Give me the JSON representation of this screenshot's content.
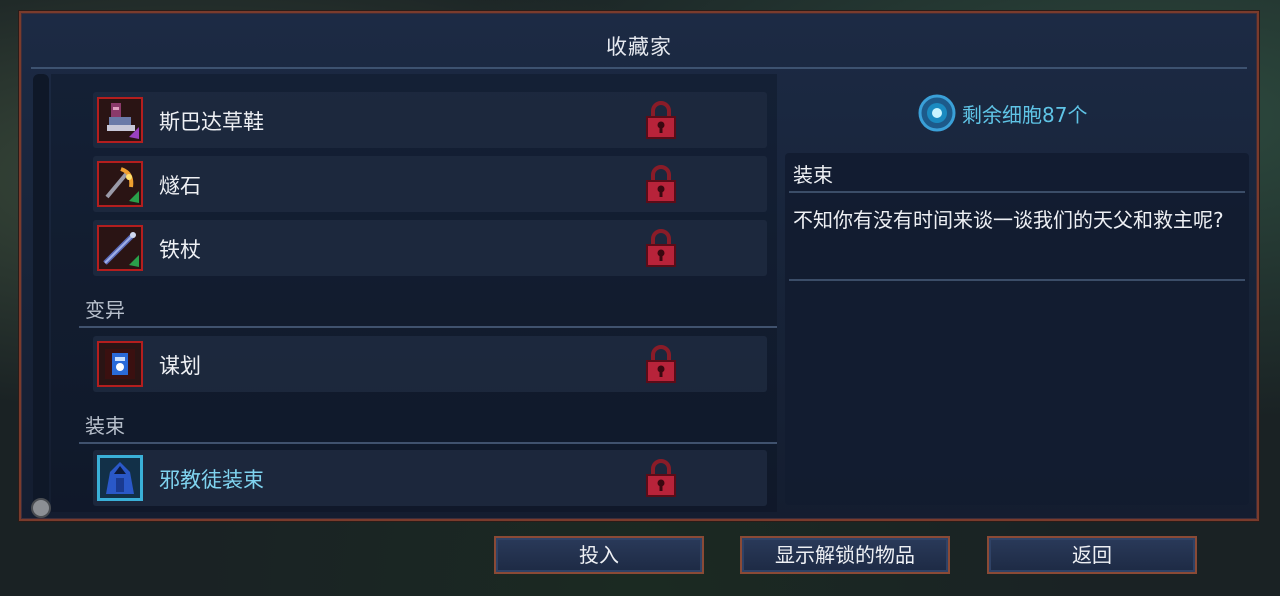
{
  "window": {
    "title": "收藏家"
  },
  "colors": {
    "accent": "#5fc4e6",
    "lock": "#c0283a",
    "frame": "#7a3b2c"
  },
  "list": {
    "group1_items": [
      {
        "label": "斯巴达草鞋",
        "icon": "sandal-icon",
        "locked": true,
        "selected": false
      },
      {
        "label": "燧石",
        "icon": "flint-icon",
        "locked": true,
        "selected": false
      },
      {
        "label": "铁杖",
        "icon": "iron-staff-icon",
        "locked": true,
        "selected": false
      }
    ],
    "section_mutation": "变异",
    "mutation_items": [
      {
        "label": "谋划",
        "icon": "scheme-icon",
        "locked": true,
        "selected": false
      }
    ],
    "section_outfit": "装束",
    "outfit_items": [
      {
        "label": "邪教徒装束",
        "icon": "cultist-outfit-icon",
        "locked": true,
        "selected": true
      }
    ]
  },
  "cells": {
    "text": "剩余细胞87个",
    "icon": "cell-icon"
  },
  "info": {
    "title": "装束",
    "description": "不知你有没有时间来谈一谈我们的天父和救主呢?"
  },
  "buttons": {
    "invest": "投入",
    "show_unlocked": "显示解锁的物品",
    "back": "返回"
  }
}
